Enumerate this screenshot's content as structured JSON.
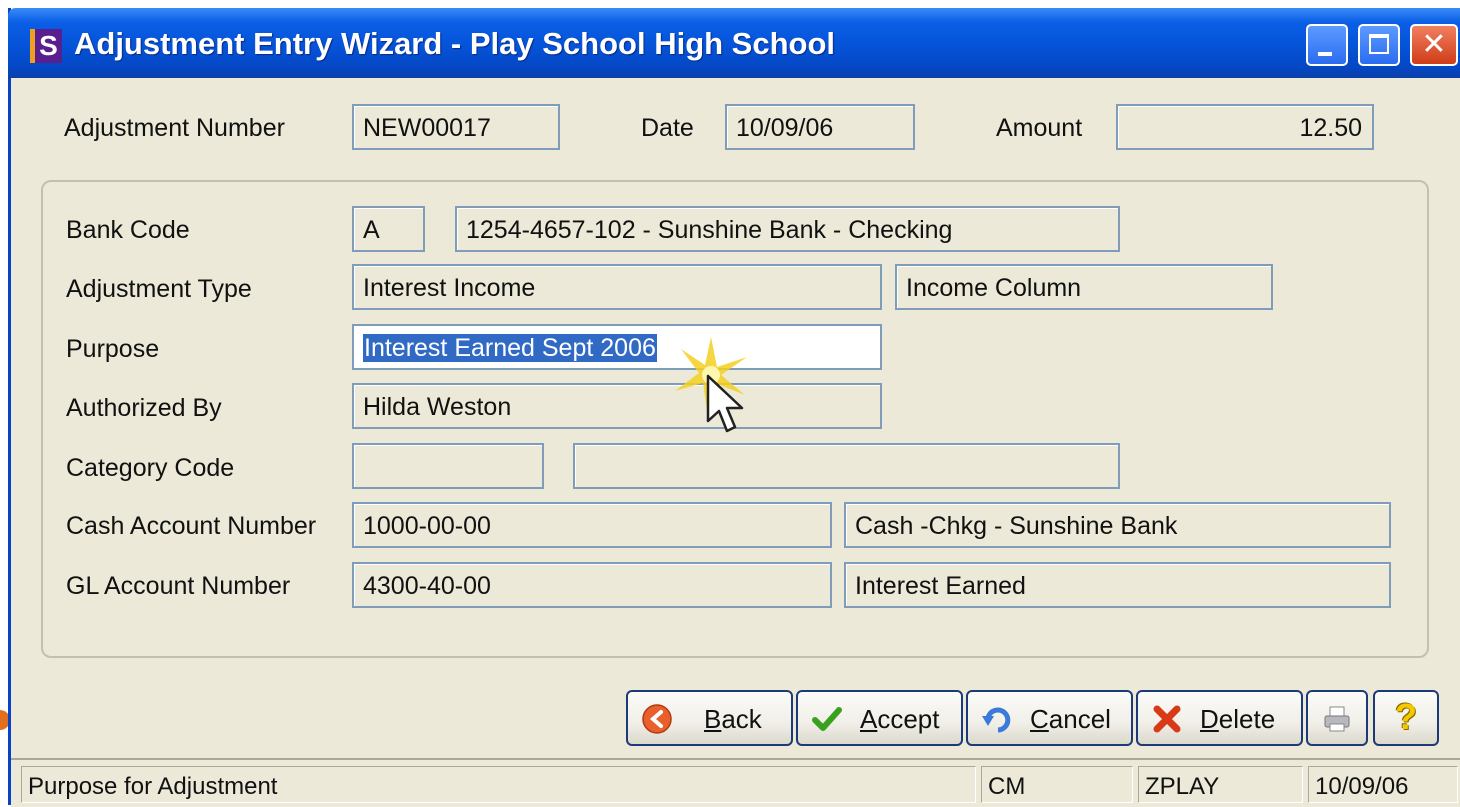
{
  "window": {
    "title": "Adjustment Entry Wizard - Play School High School",
    "icon_letter": "S",
    "controls": [
      "minimize-icon",
      "maximize-icon",
      "close-icon"
    ]
  },
  "header": {
    "adjustment_number_label": "Adjustment Number",
    "adjustment_number": "NEW00017",
    "date_label": "Date",
    "date": "10/09/06",
    "amount_label": "Amount",
    "amount": "12.50"
  },
  "form": {
    "bank_code_label": "Bank Code",
    "bank_code": "A",
    "bank_desc": "1254-4657-102 - Sunshine Bank - Checking",
    "adjustment_type_label": "Adjustment Type",
    "adjustment_type": "Interest Income",
    "adjustment_column": "Income Column",
    "purpose_label": "Purpose",
    "purpose": "Interest Earned Sept 2006",
    "authorized_by_label": "Authorized By",
    "authorized_by": "Hilda Weston",
    "category_code_label": "Category Code",
    "category_code": "",
    "category_desc": "",
    "cash_account_label": "Cash Account Number",
    "cash_account": "1000-00-00",
    "cash_account_desc": "Cash -Chkg - Sunshine Bank",
    "gl_account_label": "GL Account Number",
    "gl_account": "4300-40-00",
    "gl_account_desc": "Interest Earned"
  },
  "buttons": {
    "back": {
      "hot": "B",
      "rest": "ack",
      "icon": "back-arrow-icon"
    },
    "accept": {
      "hot": "A",
      "rest": "ccept",
      "icon": "checkmark-icon"
    },
    "cancel": {
      "hot": "C",
      "rest": "ancel",
      "icon": "undo-icon"
    },
    "delete": {
      "hot": "D",
      "rest": "elete",
      "icon": "delete-x-icon"
    },
    "print_icon": "printer-icon",
    "help_icon": "help-icon",
    "help_glyph": "?"
  },
  "statusbar": {
    "message": "Purpose for Adjustment",
    "user_initials": "CM",
    "database": "ZPLAY",
    "date": "10/09/06"
  },
  "colors": {
    "title_bar": "#0553d8",
    "window_bg": "#ece9d8",
    "field_border": "#7f9db9",
    "selection": "#316ac5"
  }
}
